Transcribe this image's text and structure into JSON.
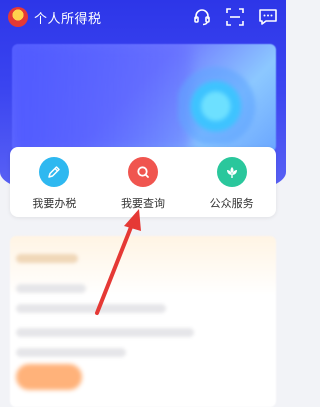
{
  "header": {
    "app_title": "个人所得税",
    "icons": [
      "headset-icon",
      "scan-icon",
      "message-icon"
    ]
  },
  "quick_actions": [
    {
      "label": "我要办税",
      "icon": "pencil-icon",
      "color": "#2eb8f0"
    },
    {
      "label": "我要查询",
      "icon": "search-icon",
      "color": "#f0554f"
    },
    {
      "label": "公众服务",
      "icon": "flower-icon",
      "color": "#2ac79c"
    }
  ],
  "colors": {
    "header_blue": "#2d36e8",
    "annotation_red": "#e53935"
  }
}
